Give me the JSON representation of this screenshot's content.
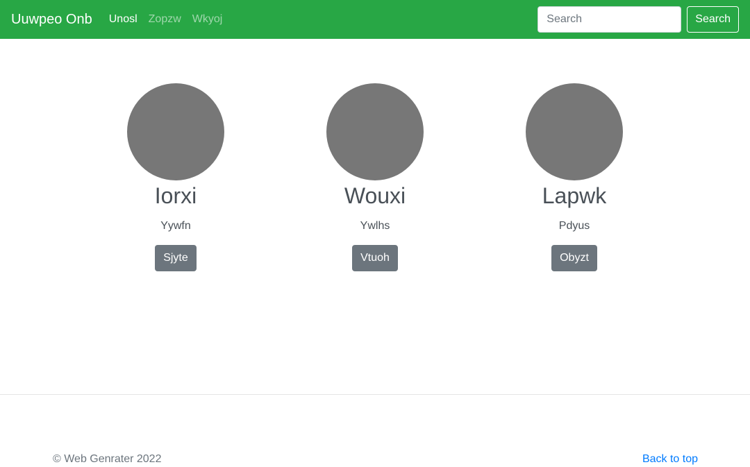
{
  "navbar": {
    "brand": "Uuwpeo Onb",
    "links": [
      {
        "label": "Unosl",
        "active": true
      },
      {
        "label": "Zopzw",
        "active": false
      },
      {
        "label": "Wkyoj",
        "active": false
      }
    ],
    "search": {
      "placeholder": "Search",
      "value": "",
      "button_label": "Search"
    },
    "background_color": "#28a745"
  },
  "people": [
    {
      "name": "Iorxi",
      "role": "Yywfn",
      "button_label": "Sjyte"
    },
    {
      "name": "Wouxi",
      "role": "Ywlhs",
      "button_label": "Vtuoh"
    },
    {
      "name": "Lapwk",
      "role": "Pdyus",
      "button_label": "Obyzt"
    }
  ],
  "footer": {
    "copyright": "© Web Genrater 2022",
    "back_to_top": "Back to top"
  }
}
